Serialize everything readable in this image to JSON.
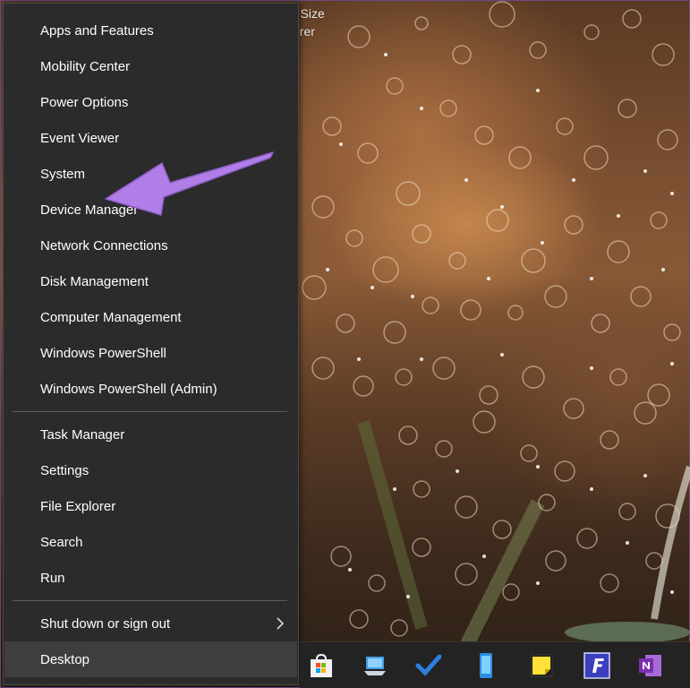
{
  "desktop": {
    "text_line_1": "r Size",
    "text_line_2": "orer"
  },
  "menu": {
    "group1": [
      {
        "label": "Apps and Features"
      },
      {
        "label": "Mobility Center"
      },
      {
        "label": "Power Options"
      },
      {
        "label": "Event Viewer"
      },
      {
        "label": "System"
      },
      {
        "label": "Device Manager"
      },
      {
        "label": "Network Connections"
      },
      {
        "label": "Disk Management"
      },
      {
        "label": "Computer Management"
      },
      {
        "label": "Windows PowerShell"
      },
      {
        "label": "Windows PowerShell (Admin)"
      }
    ],
    "group2": [
      {
        "label": "Task Manager"
      },
      {
        "label": "Settings"
      },
      {
        "label": "File Explorer"
      },
      {
        "label": "Search"
      },
      {
        "label": "Run"
      }
    ],
    "group3": [
      {
        "label": "Shut down or sign out"
      },
      {
        "label": "Desktop"
      }
    ]
  },
  "taskbar": {
    "icons": [
      "microsoft-store-icon",
      "this-pc-icon",
      "todo-check-icon",
      "phone-icon",
      "sticky-notes-icon",
      "app-f-icon",
      "onenote-icon"
    ]
  },
  "colors": {
    "menu_bg": "#2b2b2b",
    "menu_active_bg": "#3e3e3e",
    "annotation_arrow": "#b07ee6",
    "onenote": "#7b2fb0",
    "todo_blue": "#2b7fe0"
  }
}
